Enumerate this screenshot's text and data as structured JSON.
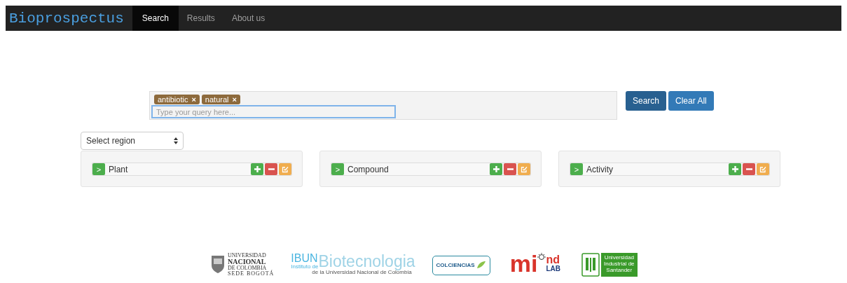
{
  "navbar": {
    "brand": "Bioprospectus",
    "items": [
      {
        "label": "Search",
        "selected": true
      },
      {
        "label": "Results",
        "selected": false
      },
      {
        "label": "About us",
        "selected": false
      }
    ]
  },
  "search": {
    "tags": [
      {
        "label": "antibiotic",
        "remove": "×"
      },
      {
        "label": "natural",
        "remove": "×"
      }
    ],
    "placeholder": "Type your query here...",
    "buttons": [
      {
        "label": "Search",
        "kind": "primary"
      },
      {
        "label": "Clear All",
        "kind": "secondary"
      }
    ]
  },
  "region_select": {
    "value": "Select region"
  },
  "panels": [
    {
      "label": "Plant",
      "expand": ">"
    },
    {
      "label": "Compound",
      "expand": ">"
    },
    {
      "label": "Activity",
      "expand": ">"
    }
  ],
  "footer_logos": [
    {
      "kind": "unal",
      "lines": [
        "UNIVERSIDAD",
        "NACIONAL",
        "DE COLOMBIA",
        "SEDE BOGOTÁ"
      ]
    },
    {
      "kind": "ibun",
      "lines": [
        "IBUN",
        "Instituto de",
        "Biotecnologia",
        "de la Universidad Nacional de Colombia"
      ]
    },
    {
      "kind": "colciencias",
      "lines": [
        "COLCIENCIAS"
      ]
    },
    {
      "kind": "mindlab",
      "lines": [
        "m",
        "i",
        "nd",
        "LAB"
      ]
    },
    {
      "kind": "uis",
      "lines": [
        "Universidad",
        "Industrial de",
        "Santander"
      ]
    }
  ]
}
